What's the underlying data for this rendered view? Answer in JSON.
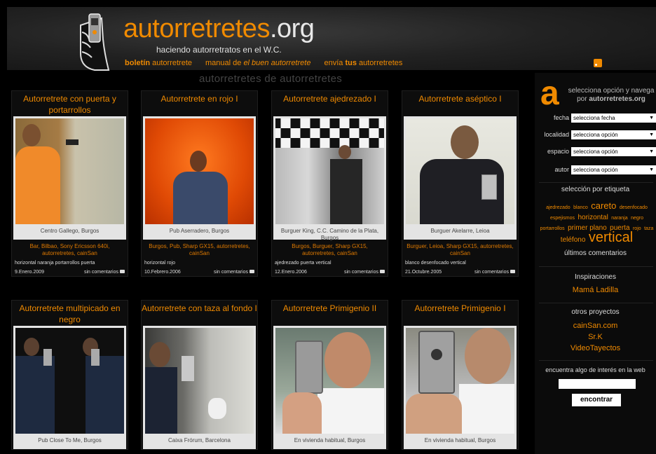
{
  "header": {
    "title_part1": "autorretretes",
    "title_part2": ".org",
    "tagline": "haciendo autorretratos en el W.C.",
    "nav": {
      "newsletter_bold": "boletín",
      "newsletter_rest": "autorretrete",
      "manual_prefix": "manual de",
      "manual_em": "el buen autorretrete",
      "send_prefix": "envía",
      "send_bold": "tus",
      "send_rest": "autorretretes"
    }
  },
  "section_heading": "autorretretes de autorretretes",
  "cards": [
    {
      "title": "Autorretrete con puerta y portarrollos",
      "caption": "Centro Gallego, Burgos",
      "tags": "Bar, Bilbao, Sony Ericsson 640i, autorretretes, cainSan",
      "meta_tags": "horizontal naranja portarrollos puerta",
      "date": "9.Enero.2009",
      "comments": "sin comentarios"
    },
    {
      "title": "Autorretrete en rojo I",
      "caption": "Pub Aserradero, Burgos",
      "tags": "Burgos, Pub, Sharp GX15, autorretretes, cainSan",
      "meta_tags": "horizontal rojo",
      "date": "10.Febrero.2006",
      "comments": "sin comentarios"
    },
    {
      "title": "Autorretrete ajedrezado I",
      "caption": "Burguer King, C.C. Camino de la Plata, Burgos",
      "tags": "Burgos, Burguer, Sharp GX15, autorretretes, cainSan",
      "meta_tags": "ajedrezado puerta vertical",
      "date": "12.Enero.2006",
      "comments": "sin comentarios"
    },
    {
      "title": "Autorretrete aséptico I",
      "caption": "Burguer Akelarre, Leioa",
      "tags": "Burguer, Leioa, Sharp GX15, autorretretes, cainSan",
      "meta_tags": "blanco desenfocado vertical",
      "date": "21.Octubre.2005",
      "comments": "sin comentarios"
    },
    {
      "title": "Autorretrete multipicado en negro",
      "caption": "Pub Close To Me, Burgos"
    },
    {
      "title": "Autorretrete con taza al fondo I",
      "caption": "Caixa Frórum, Barcelona"
    },
    {
      "title": "Autorretrete Primigenio II",
      "caption": "En vivienda habitual, Burgos"
    },
    {
      "title": "Autorretrete Primigenio I",
      "caption": "En vivienda habitual, Burgos"
    }
  ],
  "sidebar": {
    "logo_letter": "a",
    "intro_line1": "selecciona opción y navega",
    "intro_prefix": "por",
    "intro_site": "autorretretes.org",
    "filters": [
      {
        "label": "fecha",
        "value": "selecciona fecha"
      },
      {
        "label": "localidad",
        "value": "selecciona opción"
      },
      {
        "label": "espacio",
        "value": "selecciona opción"
      },
      {
        "label": "autor",
        "value": "selecciona opción"
      }
    ],
    "tag_heading": "selección por etiqueta",
    "tags": {
      "t1": "ajedrezado",
      "t2": "blanco",
      "t3": "careto",
      "t4": "desenfocado",
      "t5": "espejismos",
      "t6": "horizontal",
      "t7": "naranja",
      "t8": "negro",
      "t9": "portarrollos",
      "t10": "primer plano",
      "t11": "puerta",
      "t12": "rojo",
      "t13": "taza",
      "t14": "teléfono",
      "t15": "vertical"
    },
    "latest_comments": "últimos comentarios",
    "inspirations_heading": "Inspiraciones",
    "inspiration_link": "Mamá Ladilla",
    "projects_heading": "otros proyectos",
    "projects": [
      "cainSan.com",
      "Sr.K",
      "VideoTayectos"
    ],
    "search_heading": "encuentra algo de interés en la web",
    "search_button": "encontrar"
  },
  "colors": {
    "accent": "#f08a00",
    "background": "#000000"
  }
}
